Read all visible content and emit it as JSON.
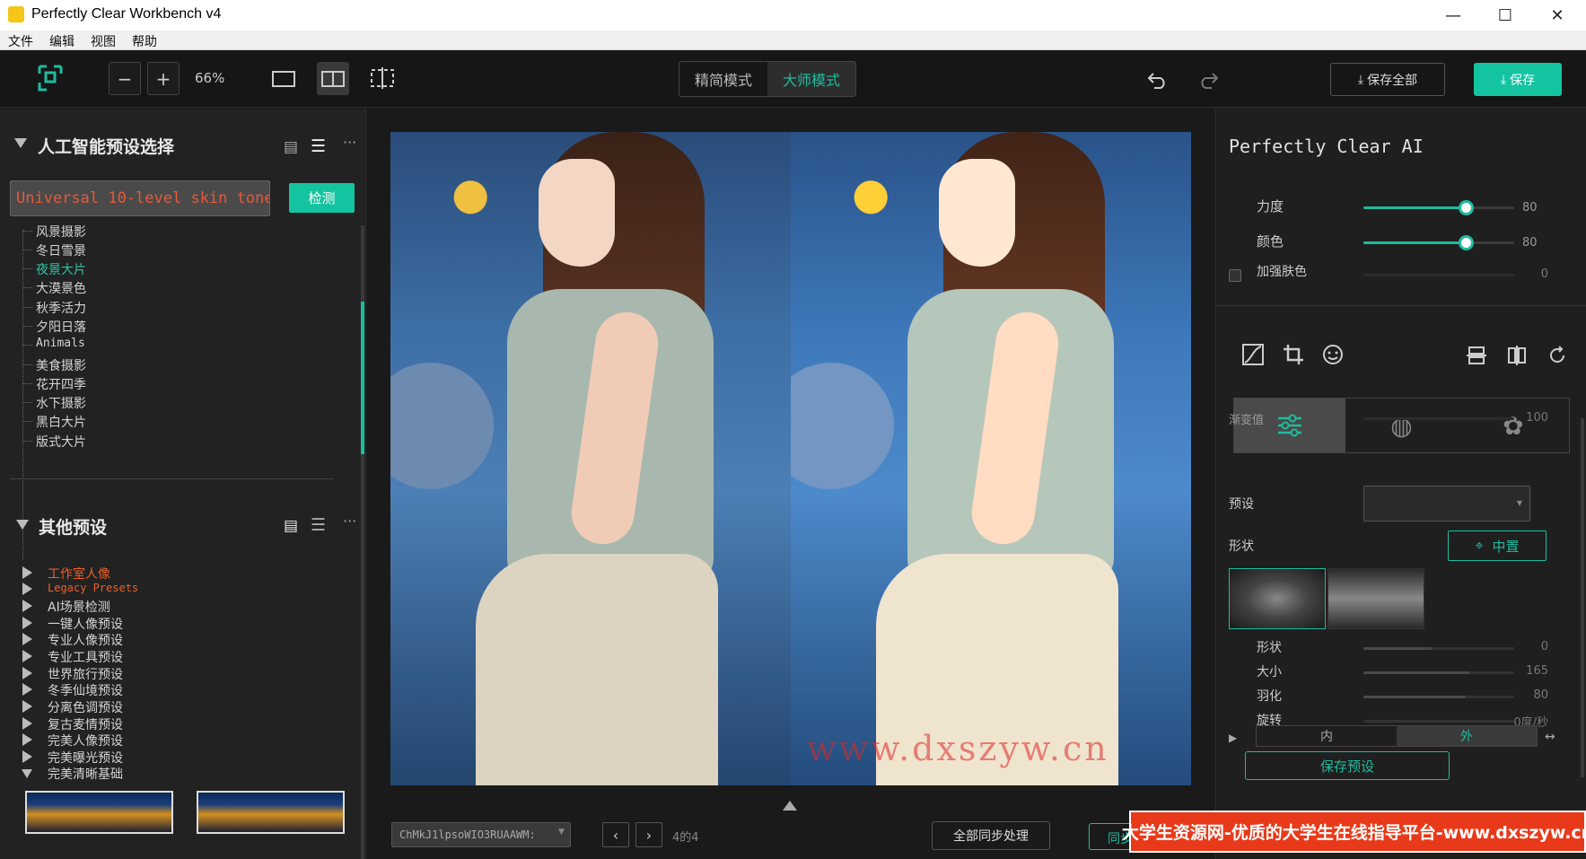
{
  "window": {
    "title": "Perfectly Clear Workbench v4",
    "minimize": "—",
    "maximize": "☐",
    "close": "✕"
  },
  "menu": [
    "文件",
    "编辑",
    "视图",
    "帮助"
  ],
  "toolbar": {
    "zoom": "66%",
    "modes": [
      "精简模式",
      "大师模式"
    ],
    "active_mode": "大师模式",
    "save_all_label": "保存全部",
    "save_label": "保存",
    "undo_icon": "undo-icon",
    "redo_icon": "redo-icon"
  },
  "ai_presets": {
    "title": "人工智能预设选择",
    "input_value": "Universal 10-level skin tone",
    "detect_label": "检测",
    "items": [
      "风景摄影",
      "冬日雪景",
      "夜景大片",
      "大漠景色",
      "秋季活力",
      "夕阳日落",
      "Animals",
      "美食摄影",
      "花开四季",
      "水下摄影",
      "黑白大片",
      "版式大片"
    ],
    "highlighted": "夜景大片"
  },
  "other_presets": {
    "title": "其他预设",
    "items": [
      "工作室人像",
      "Legacy Presets",
      "AI场景检测",
      "一键人像预设",
      "专业人像预设",
      "专业工具预设",
      "世界旅行预设",
      "冬季仙境预设",
      "分离色调预设",
      "复古麦情预设",
      "完美人像预设",
      "完美曝光预设",
      "完美清晰基础"
    ],
    "colored": [
      "工作室人像",
      "Legacy Presets"
    ]
  },
  "watermark": "www.dxszyw.cn",
  "bottom": {
    "file_combo": "ChMkJ1lpsoWIO3RUAAWM:",
    "page_count": "4的4",
    "sync_label": "全部同步处理",
    "mini_label": "同步"
  },
  "right_panel": {
    "title": "Perfectly Clear AI",
    "sliders": [
      {
        "label": "力度",
        "value": "80",
        "pct": 0.68
      },
      {
        "label": "颜色",
        "value": "80",
        "pct": 0.68
      }
    ],
    "enhance_skin": {
      "label": "加强肤色",
      "value": "0"
    },
    "partial_label": "渐变值",
    "partial_value": "100",
    "preset_label": "预设",
    "shape_label": "形状",
    "center_label": "中置",
    "shape_sliders": [
      {
        "label": "形状",
        "value": "0",
        "pct": 0.45
      },
      {
        "label": "大小",
        "value": "165",
        "pct": 0.7
      },
      {
        "label": "羽化",
        "value": "80",
        "pct": 0.68
      },
      {
        "label": "旋转",
        "value": "0度/秒",
        "pct": 0.0
      }
    ],
    "inout": [
      "内",
      "外"
    ],
    "save_preset_label": "保存预设"
  },
  "banner": "大学生资源网-优质的大学生在线指导平台-www.dxszyw.cn",
  "colors": {
    "accent": "#1ebc9e",
    "highlight_text": "#2ec4a6",
    "orange_text": "#e8622c",
    "banner": "#e83a1a"
  }
}
